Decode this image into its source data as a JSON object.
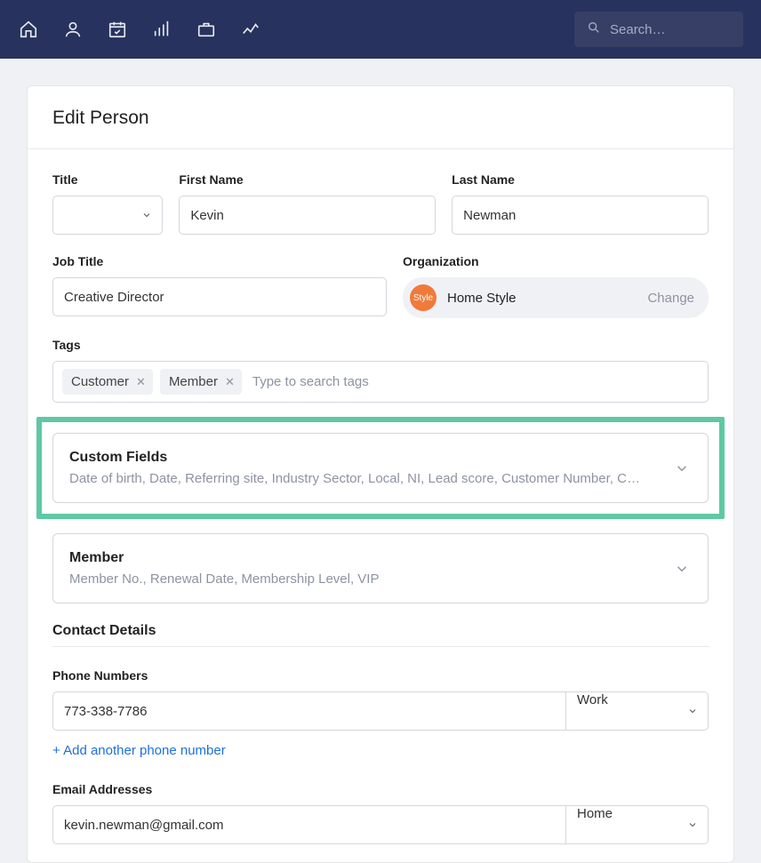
{
  "nav": {
    "search_placeholder": "Search…"
  },
  "page": {
    "title": "Edit Person"
  },
  "fields": {
    "title_label": "Title",
    "title_value": "",
    "first_name_label": "First Name",
    "first_name_value": "Kevin",
    "last_name_label": "Last Name",
    "last_name_value": "Newman",
    "job_title_label": "Job Title",
    "job_title_value": "Creative Director",
    "organization_label": "Organization",
    "organization_name": "Home Style",
    "organization_avatar_text": "Style",
    "organization_change": "Change"
  },
  "tags": {
    "label": "Tags",
    "items": [
      "Customer",
      "Member"
    ],
    "placeholder": "Type to search tags"
  },
  "sections": {
    "custom_fields": {
      "title": "Custom Fields",
      "subtitle": "Date of birth, Date, Referring site, Industry Sector, Local, NI, Lead score, Customer Number, C…"
    },
    "member": {
      "title": "Member",
      "subtitle": "Member No., Renewal Date, Membership Level, VIP"
    }
  },
  "contact": {
    "heading": "Contact Details",
    "phone_label": "Phone Numbers",
    "phone_value": "773-338-7786",
    "phone_type": "Work",
    "add_phone": "+ Add another phone number",
    "email_label": "Email Addresses",
    "email_value": "kevin.newman@gmail.com",
    "email_type": "Home"
  }
}
